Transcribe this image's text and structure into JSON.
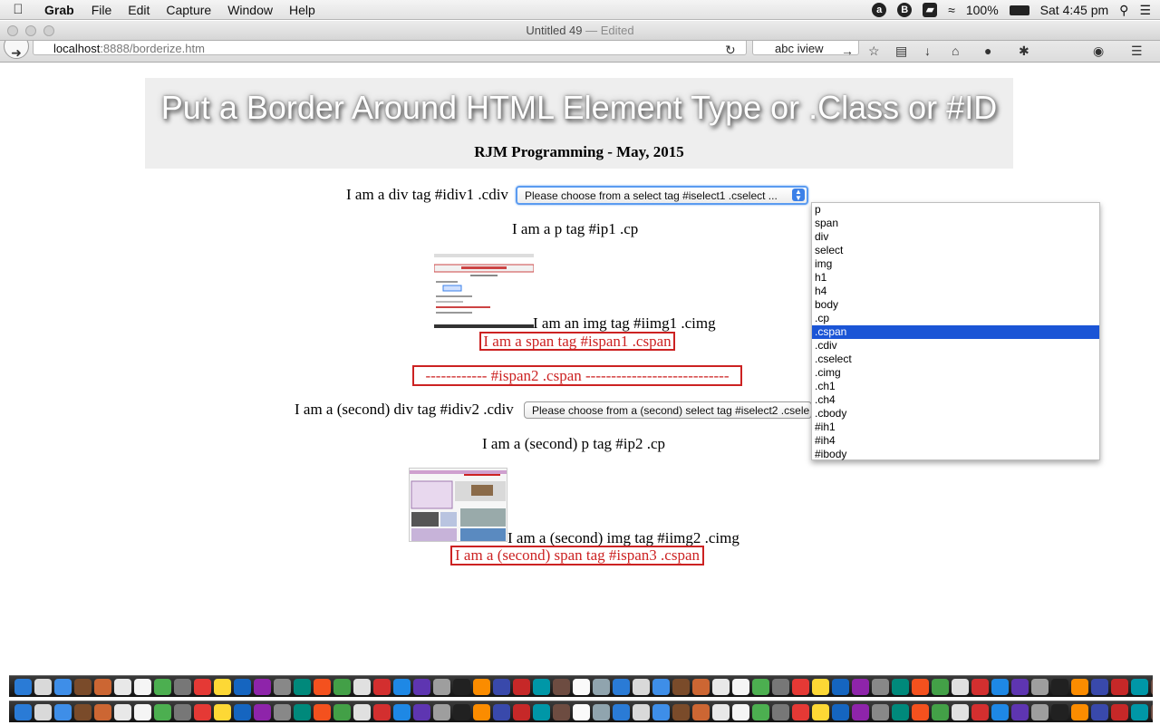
{
  "menubar": {
    "app": "Grab",
    "items": [
      "File",
      "Edit",
      "Capture",
      "Window",
      "Help"
    ],
    "battery": "100%",
    "clock": "Sat 4:45 pm"
  },
  "window": {
    "title": "Untitled 49",
    "separator": "—",
    "status": "Edited"
  },
  "browser": {
    "url_host": "localhost",
    "url_path": ":8888/borderize.htm",
    "search_text": "abc iview"
  },
  "page": {
    "title": "Put a Border Around HTML Element Type or .Class or #ID",
    "subtitle": "RJM Programming - May, 2015",
    "div1_text": "I am a div tag #idiv1 .cdiv",
    "select1_value": "Please choose from a select tag #iselect1 .cselect ...",
    "p1_text": "I am a p tag #ip1 .cp",
    "img1_text": "I am an img tag #iimg1 .cimg",
    "span1_text": "I am a span tag #ispan1 .cspan",
    "span2_text": "------------ #ispan2 .cspan ----------------------------",
    "div2_text": "I am a (second) div tag #idiv2 .cdiv",
    "select2_value": "Please choose from a (second) select tag #iselect2 .csele",
    "p2_text": "I am a (second) p tag #ip2 .cp",
    "img2_text": "I am a (second) img tag #iimg2 .cimg",
    "span3_text": "I am a (second) span tag #ispan3 .cspan"
  },
  "dropdown": {
    "options": [
      "p",
      "span",
      "div",
      "select",
      "img",
      "h1",
      "h4",
      "body",
      ".cp",
      ".cspan",
      ".cdiv",
      ".cselect",
      ".cimg",
      ".ch1",
      ".ch4",
      ".cbody",
      "#ih1",
      "#ih4",
      "#ibody"
    ],
    "highlighted": ".cspan"
  },
  "colors": {
    "accent": "#1b55d6",
    "border_red": "#cc2222",
    "banner_bg": "#eeeeee"
  }
}
